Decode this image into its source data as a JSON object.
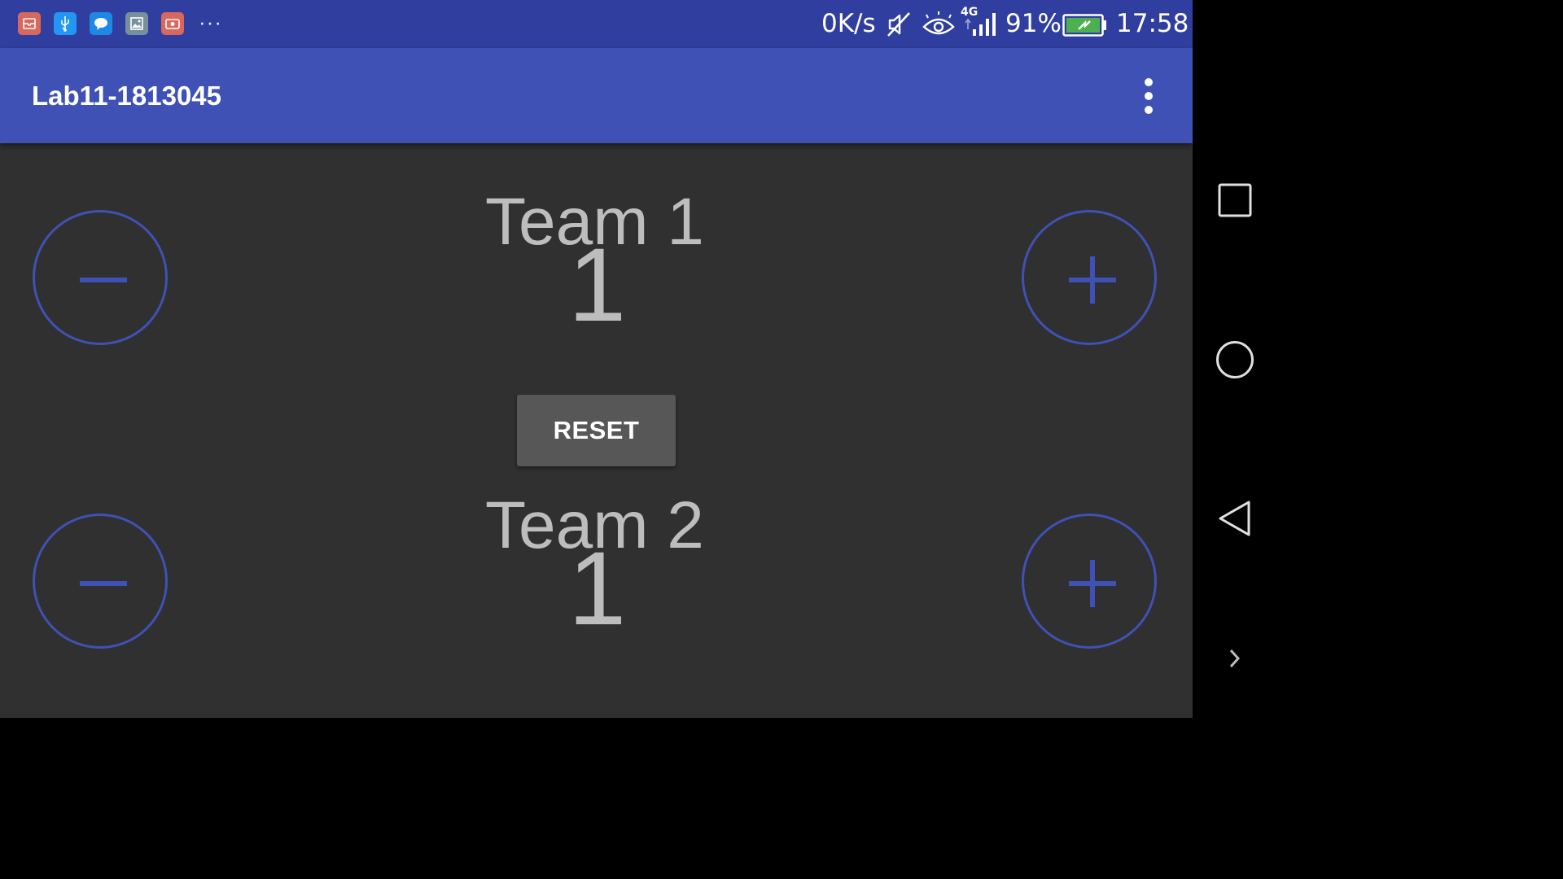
{
  "status_bar": {
    "notification_icons": [
      "mail-icon",
      "usb-icon",
      "chat-icon",
      "gallery-icon",
      "screen-recorder-icon"
    ],
    "more_indicator": "···",
    "network_speed": "0K/s",
    "network_type": "4G",
    "battery_percent": "91%",
    "time": "17:58"
  },
  "app_bar": {
    "title": "Lab11-1813045",
    "overflow_icon": "more-vert-icon"
  },
  "teams": [
    {
      "label": "Team 1",
      "score": "1"
    },
    {
      "label": "Team 2",
      "score": "1"
    }
  ],
  "controls": {
    "reset_label": "RESET",
    "decrement_icon": "minus-icon",
    "increment_icon": "plus-icon"
  },
  "nav_bar": {
    "buttons": [
      "recents-icon",
      "home-icon",
      "back-icon",
      "expand-icon"
    ]
  },
  "colors": {
    "status_bar": "#303f9f",
    "app_bar": "#3f51b5",
    "background": "#303030",
    "accent": "#3f51b5",
    "text_secondary": "#bdbdbd",
    "reset_button": "#575757",
    "battery_fill": "#4caf50"
  }
}
